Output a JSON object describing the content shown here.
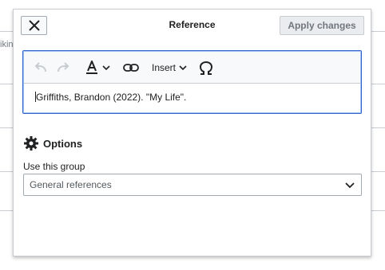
{
  "background": {
    "fragment_text": "ikin"
  },
  "dialog": {
    "title": "Reference",
    "close_icon": "close-icon",
    "apply_label": "Apply changes"
  },
  "toolbar": {
    "undo_icon": "undo-icon",
    "redo_icon": "redo-icon",
    "text_style_icon": "text-style-icon",
    "link_icon": "link-icon",
    "insert_label": "Insert",
    "special_char_icon": "omega-icon"
  },
  "editor": {
    "content": "Griffiths, Brandon (2022). \"My Life\"."
  },
  "options": {
    "title": "Options",
    "icon": "gear-icon",
    "group_label": "Use this group",
    "group_value": "General references"
  },
  "colors": {
    "accent": "#3366cc",
    "border": "#a2a9b1",
    "text": "#202122",
    "disabled_text": "#72777d"
  }
}
